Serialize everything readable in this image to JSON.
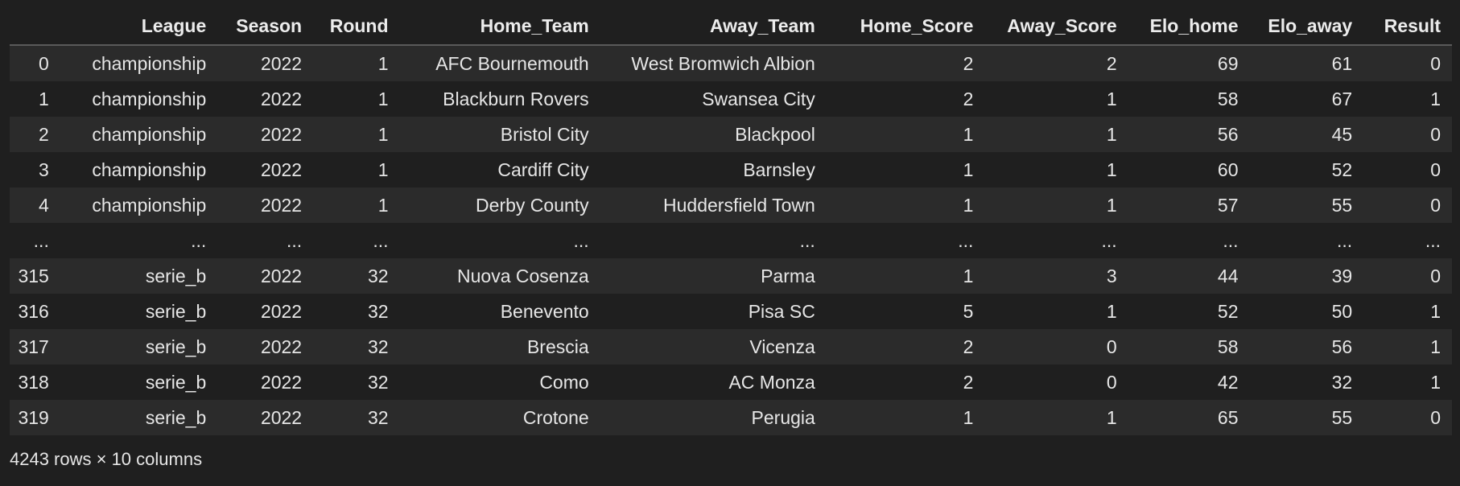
{
  "table": {
    "columns": [
      "",
      "League",
      "Season",
      "Round",
      "Home_Team",
      "Away_Team",
      "Home_Score",
      "Away_Score",
      "Elo_home",
      "Elo_away",
      "Result"
    ],
    "rows": [
      [
        "0",
        "championship",
        "2022",
        "1",
        "AFC Bournemouth",
        "West Bromwich Albion",
        "2",
        "2",
        "69",
        "61",
        "0"
      ],
      [
        "1",
        "championship",
        "2022",
        "1",
        "Blackburn Rovers",
        "Swansea City",
        "2",
        "1",
        "58",
        "67",
        "1"
      ],
      [
        "2",
        "championship",
        "2022",
        "1",
        "Bristol City",
        "Blackpool",
        "1",
        "1",
        "56",
        "45",
        "0"
      ],
      [
        "3",
        "championship",
        "2022",
        "1",
        "Cardiff City",
        "Barnsley",
        "1",
        "1",
        "60",
        "52",
        "0"
      ],
      [
        "4",
        "championship",
        "2022",
        "1",
        "Derby County",
        "Huddersfield Town",
        "1",
        "1",
        "57",
        "55",
        "0"
      ],
      [
        "...",
        "...",
        "...",
        "...",
        "...",
        "...",
        "...",
        "...",
        "...",
        "...",
        "..."
      ],
      [
        "315",
        "serie_b",
        "2022",
        "32",
        "Nuova Cosenza",
        "Parma",
        "1",
        "3",
        "44",
        "39",
        "0"
      ],
      [
        "316",
        "serie_b",
        "2022",
        "32",
        "Benevento",
        "Pisa SC",
        "5",
        "1",
        "52",
        "50",
        "1"
      ],
      [
        "317",
        "serie_b",
        "2022",
        "32",
        "Brescia",
        "Vicenza",
        "2",
        "0",
        "58",
        "56",
        "1"
      ],
      [
        "318",
        "serie_b",
        "2022",
        "32",
        "Como",
        "AC Monza",
        "2",
        "0",
        "42",
        "32",
        "1"
      ],
      [
        "319",
        "serie_b",
        "2022",
        "32",
        "Crotone",
        "Perugia",
        "1",
        "1",
        "65",
        "55",
        "0"
      ]
    ]
  },
  "footer": {
    "summary": "4243 rows × 10 columns"
  }
}
